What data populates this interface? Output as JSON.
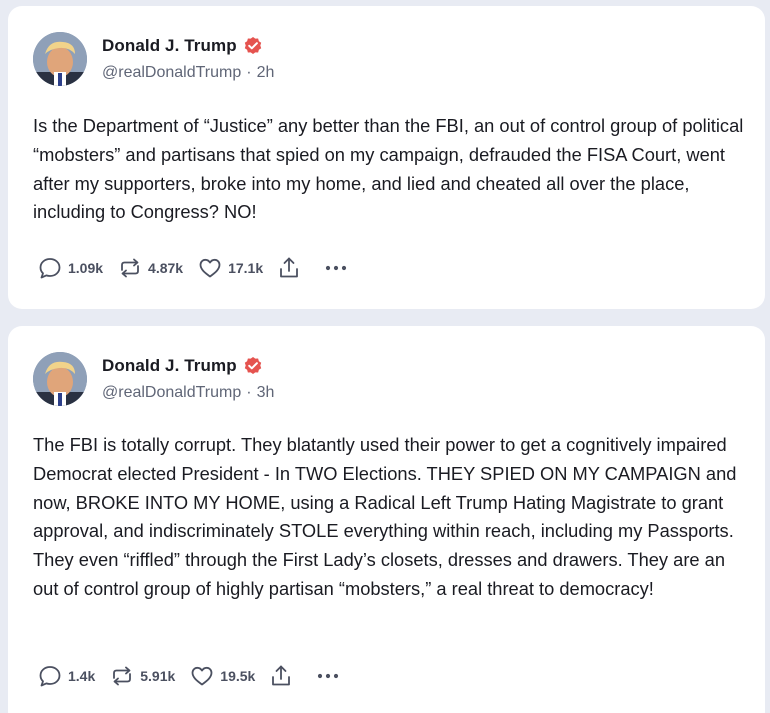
{
  "colors": {
    "verified_badge": "#e5534f",
    "page_background": "#e8ebf3",
    "card_background": "#ffffff",
    "text_primary": "#1a1b22",
    "text_secondary": "#606677"
  },
  "posts": [
    {
      "author": {
        "display_name": "Donald J. Trump",
        "verified_icon": "verified-badge-icon",
        "handle": "@realDonaldTrump",
        "separator": "·",
        "time_ago": "2h"
      },
      "text": "Is the Department of “Justice” any better than the FBI, an out of control group of political “mobsters” and partisans that spied on my campaign, defrauded the FISA Court, went after my supporters, broke into my home, and lied and cheated all over the place, including to Congress? NO!",
      "stats": {
        "replies": "1.09k",
        "reposts": "4.87k",
        "likes": "17.1k"
      }
    },
    {
      "author": {
        "display_name": "Donald J. Trump",
        "verified_icon": "verified-badge-icon",
        "handle": "@realDonaldTrump",
        "separator": "·",
        "time_ago": "3h"
      },
      "text": "The FBI is totally corrupt. They blatantly used their power to get a cognitively impaired Democrat elected President - In TWO Elections. THEY SPIED ON MY CAMPAIGN and now, BROKE INTO MY HOME, using a Radical Left Trump Hating Magistrate to grant approval, and indiscriminately STOLE everything within reach, including my Passports. They even “riffled” through the First Lady’s closets, dresses and drawers. They are an out of control group of highly partisan “mobsters,” a real threat to democracy!",
      "stats": {
        "replies": "1.4k",
        "reposts": "5.91k",
        "likes": "19.5k"
      }
    }
  ]
}
